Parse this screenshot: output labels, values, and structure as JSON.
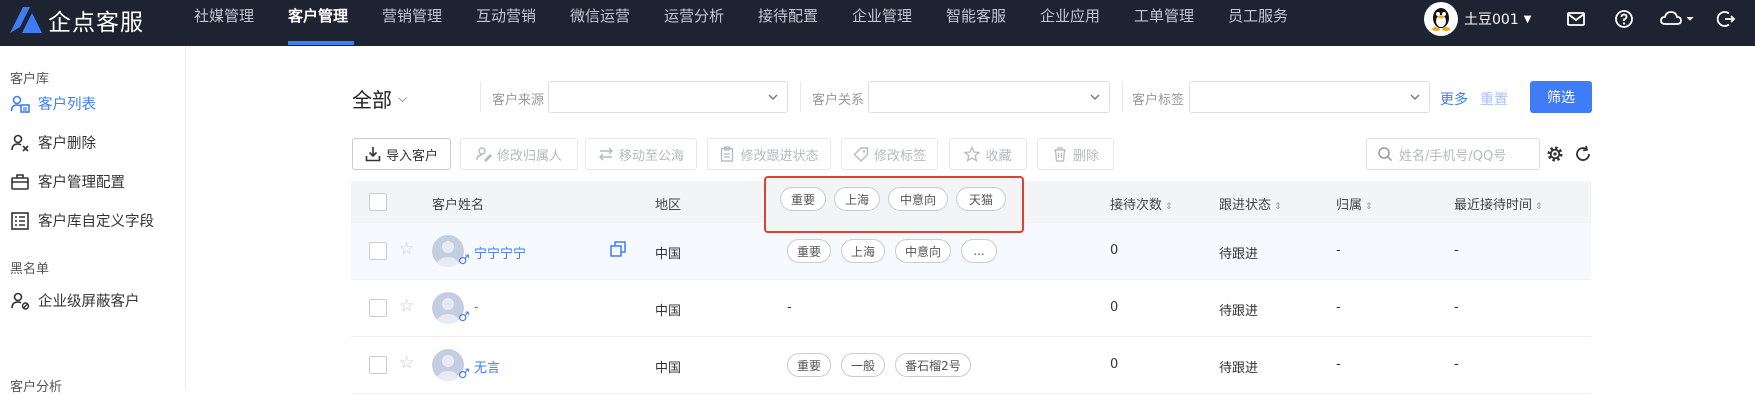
{
  "brand": {
    "name": "企点客服",
    "accent": "#3f7cf5",
    "nav_bg": "#1d2330",
    "highlight": "#e0402f"
  },
  "nav": {
    "items": [
      "社媒管理",
      "客户管理",
      "营销管理",
      "互动营销",
      "微信运营",
      "运营分析",
      "接待配置",
      "企业管理",
      "智能客服",
      "企业应用",
      "工单管理",
      "员工服务"
    ],
    "active_index": 1
  },
  "user": {
    "name": "土豆001",
    "icons": [
      "mail-icon",
      "help-icon",
      "cloud-icon",
      "logout-icon"
    ]
  },
  "sidebar": {
    "section1": "客户库",
    "items1": [
      {
        "label": "客户列表",
        "icon": "customer-list-icon"
      },
      {
        "label": "客户删除",
        "icon": "user-delete-icon"
      },
      {
        "label": "客户管理配置",
        "icon": "briefcase-icon"
      },
      {
        "label": "客户库自定义字段",
        "icon": "custom-field-icon"
      }
    ],
    "section2": "黑名单",
    "items2": [
      {
        "label": "企业级屏蔽客户",
        "icon": "user-block-icon"
      }
    ],
    "section3": "客户分析"
  },
  "filters": {
    "scope": "全部",
    "source_label": "客户来源",
    "relation_label": "客户关系",
    "tag_label": "客户标签",
    "more": "更多",
    "reset": "重置",
    "apply": "筛选"
  },
  "actions": {
    "import": "导入客户",
    "change_owner": "修改归属人",
    "move_public": "移动至公海",
    "change_status": "修改跟进状态",
    "change_tags": "修改标签",
    "favorite": "收藏",
    "delete": "删除",
    "search_placeholder": "姓名/手机号/QQ号"
  },
  "table": {
    "headers": {
      "name": "客户姓名",
      "region": "地区",
      "visits": "接待次数",
      "status": "跟进状态",
      "owner": "归属",
      "last_visit": "最近接待时间"
    },
    "popover_tags": [
      "重要",
      "上海",
      "中意向",
      "天猫"
    ],
    "rows": [
      {
        "name": "宁宁宁宁",
        "region": "中国",
        "tags": [
          "重要",
          "上海",
          "中意向",
          "..."
        ],
        "visits": "0",
        "status": "待跟进",
        "owner": "-",
        "last_visit": "-"
      },
      {
        "name": "-",
        "region": "中国",
        "tags_text": "-",
        "visits": "0",
        "status": "待跟进",
        "owner": "-",
        "last_visit": "-"
      },
      {
        "name": "无言",
        "region": "中国",
        "tags": [
          "重要",
          "一般",
          "番石榴2号"
        ],
        "visits": "0",
        "status": "待跟进",
        "owner": "-",
        "last_visit": "-"
      }
    ]
  }
}
